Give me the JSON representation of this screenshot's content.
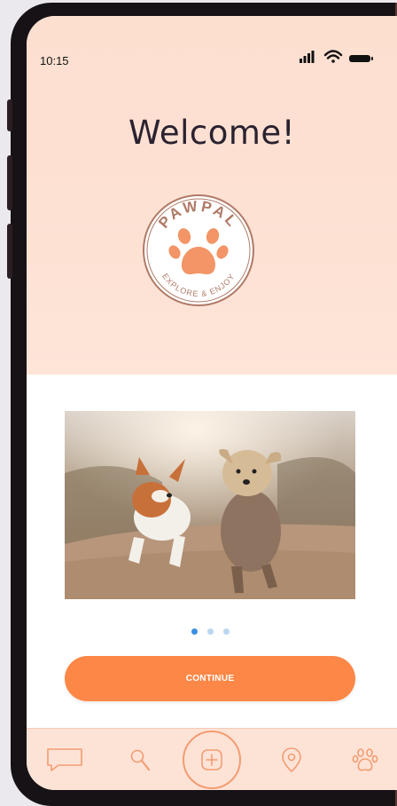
{
  "status_bar": {
    "time": "10:15"
  },
  "welcome": {
    "title": "Welcome!"
  },
  "logo": {
    "brand": "PAWPAL",
    "tagline": "EXPLORE & ENJOY"
  },
  "carousel": {
    "pages": 3,
    "active_index": 0
  },
  "actions": {
    "continue_label": "CONTINUE"
  },
  "tabbar": {
    "items": [
      {
        "icon": "chat-icon"
      },
      {
        "icon": "search-icon"
      },
      {
        "icon": "plus-icon"
      },
      {
        "icon": "location-pin-icon"
      },
      {
        "icon": "paw-icon"
      }
    ]
  },
  "colors": {
    "accent": "#fd8747",
    "hero_background": "#fde1d3",
    "dot_active": "#3b8fe0",
    "dot_inactive": "#bcd6f0",
    "logo_brown": "#b07a66",
    "icon_outline": "#f39c72"
  }
}
